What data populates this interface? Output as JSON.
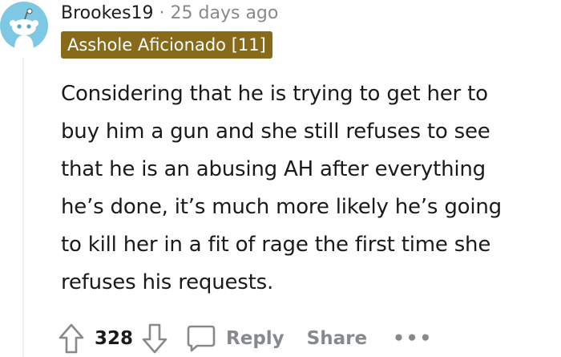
{
  "comment": {
    "username": "Brookes19",
    "separator": "·",
    "timestamp": "25 days ago",
    "flair": "Asshole Aficionado [11]",
    "body_lines": [
      "Considering that he is trying to get her to",
      "buy him a gun and she still refuses to see",
      "that he is an abusing AH after everything",
      "he’s done, it’s much more likely he’s going",
      "to kill her in a fit of rage the first time she",
      "refuses his requests."
    ],
    "upvotes": "328",
    "reply_label": "Reply",
    "share_label": "Share",
    "more_label": "•••"
  },
  "colors": {
    "flair_bg": "#876b1a",
    "avatar_bg": "#7ec8e3",
    "muted": "#878a8c"
  },
  "icons": {
    "avatar": "reddit-snoo-avatar-icon",
    "upvote": "upvote-arrow-icon",
    "downvote": "downvote-arrow-icon",
    "reply": "comment-bubble-icon"
  }
}
